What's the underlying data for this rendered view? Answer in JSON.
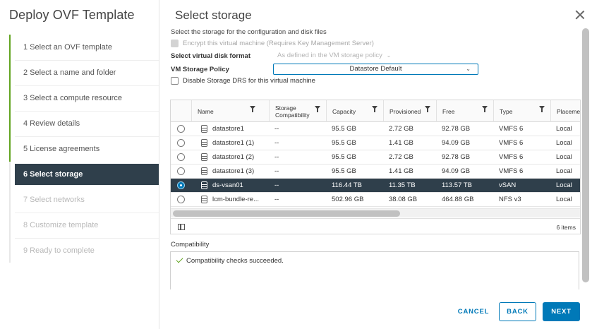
{
  "wizard": {
    "title": "Deploy OVF Template",
    "steps": [
      {
        "label": "1  Select an OVF template",
        "state": "done"
      },
      {
        "label": "2  Select a name and folder",
        "state": "done"
      },
      {
        "label": "3  Select a compute resource",
        "state": "done"
      },
      {
        "label": "4  Review details",
        "state": "done"
      },
      {
        "label": "5  License agreements",
        "state": "done"
      },
      {
        "label": "6  Select storage",
        "state": "active"
      },
      {
        "label": "7  Select networks",
        "state": "disabled"
      },
      {
        "label": "8  Customize template",
        "state": "disabled"
      },
      {
        "label": "9  Ready to complete",
        "state": "disabled"
      }
    ]
  },
  "page": {
    "title": "Select storage",
    "description": "Select the storage for the configuration and disk files",
    "encrypt_label": "Encrypt this virtual machine (Requires Key Management Server)",
    "disk_format_label": "Select virtual disk format",
    "disk_format_value": "As defined in the VM storage policy",
    "policy_label": "VM Storage Policy",
    "policy_value": "Datastore Default",
    "disable_drs_label": "Disable Storage DRS for this virtual machine"
  },
  "grid": {
    "columns": [
      "Name",
      "Storage Compatibility",
      "Capacity",
      "Provisioned",
      "Free",
      "Type",
      "Placeme"
    ],
    "rows": [
      {
        "name": "datastore1",
        "compat": "--",
        "capacity": "95.5 GB",
        "provisioned": "2.72 GB",
        "free": "92.78 GB",
        "type": "VMFS 6",
        "placement": "Local",
        "selected": false
      },
      {
        "name": "datastore1 (1)",
        "compat": "--",
        "capacity": "95.5 GB",
        "provisioned": "1.41 GB",
        "free": "94.09 GB",
        "type": "VMFS 6",
        "placement": "Local",
        "selected": false
      },
      {
        "name": "datastore1 (2)",
        "compat": "--",
        "capacity": "95.5 GB",
        "provisioned": "2.72 GB",
        "free": "92.78 GB",
        "type": "VMFS 6",
        "placement": "Local",
        "selected": false
      },
      {
        "name": "datastore1 (3)",
        "compat": "--",
        "capacity": "95.5 GB",
        "provisioned": "1.41 GB",
        "free": "94.09 GB",
        "type": "VMFS 6",
        "placement": "Local",
        "selected": false
      },
      {
        "name": "ds-vsan01",
        "compat": "--",
        "capacity": "116.44 TB",
        "provisioned": "11.35 TB",
        "free": "113.57 TB",
        "type": "vSAN",
        "placement": "Local",
        "selected": true
      },
      {
        "name": "lcm-bundle-re...",
        "compat": "--",
        "capacity": "502.96 GB",
        "provisioned": "38.08 GB",
        "free": "464.88 GB",
        "type": "NFS v3",
        "placement": "Local",
        "selected": false
      }
    ],
    "items_count": "6 items"
  },
  "compatibility": {
    "label": "Compatibility",
    "message": "Compatibility checks succeeded."
  },
  "buttons": {
    "cancel": "CANCEL",
    "back": "BACK",
    "next": "NEXT"
  },
  "colors": {
    "accent": "#0079b8",
    "active_step": "#2f3f4b",
    "success": "#62a420"
  }
}
